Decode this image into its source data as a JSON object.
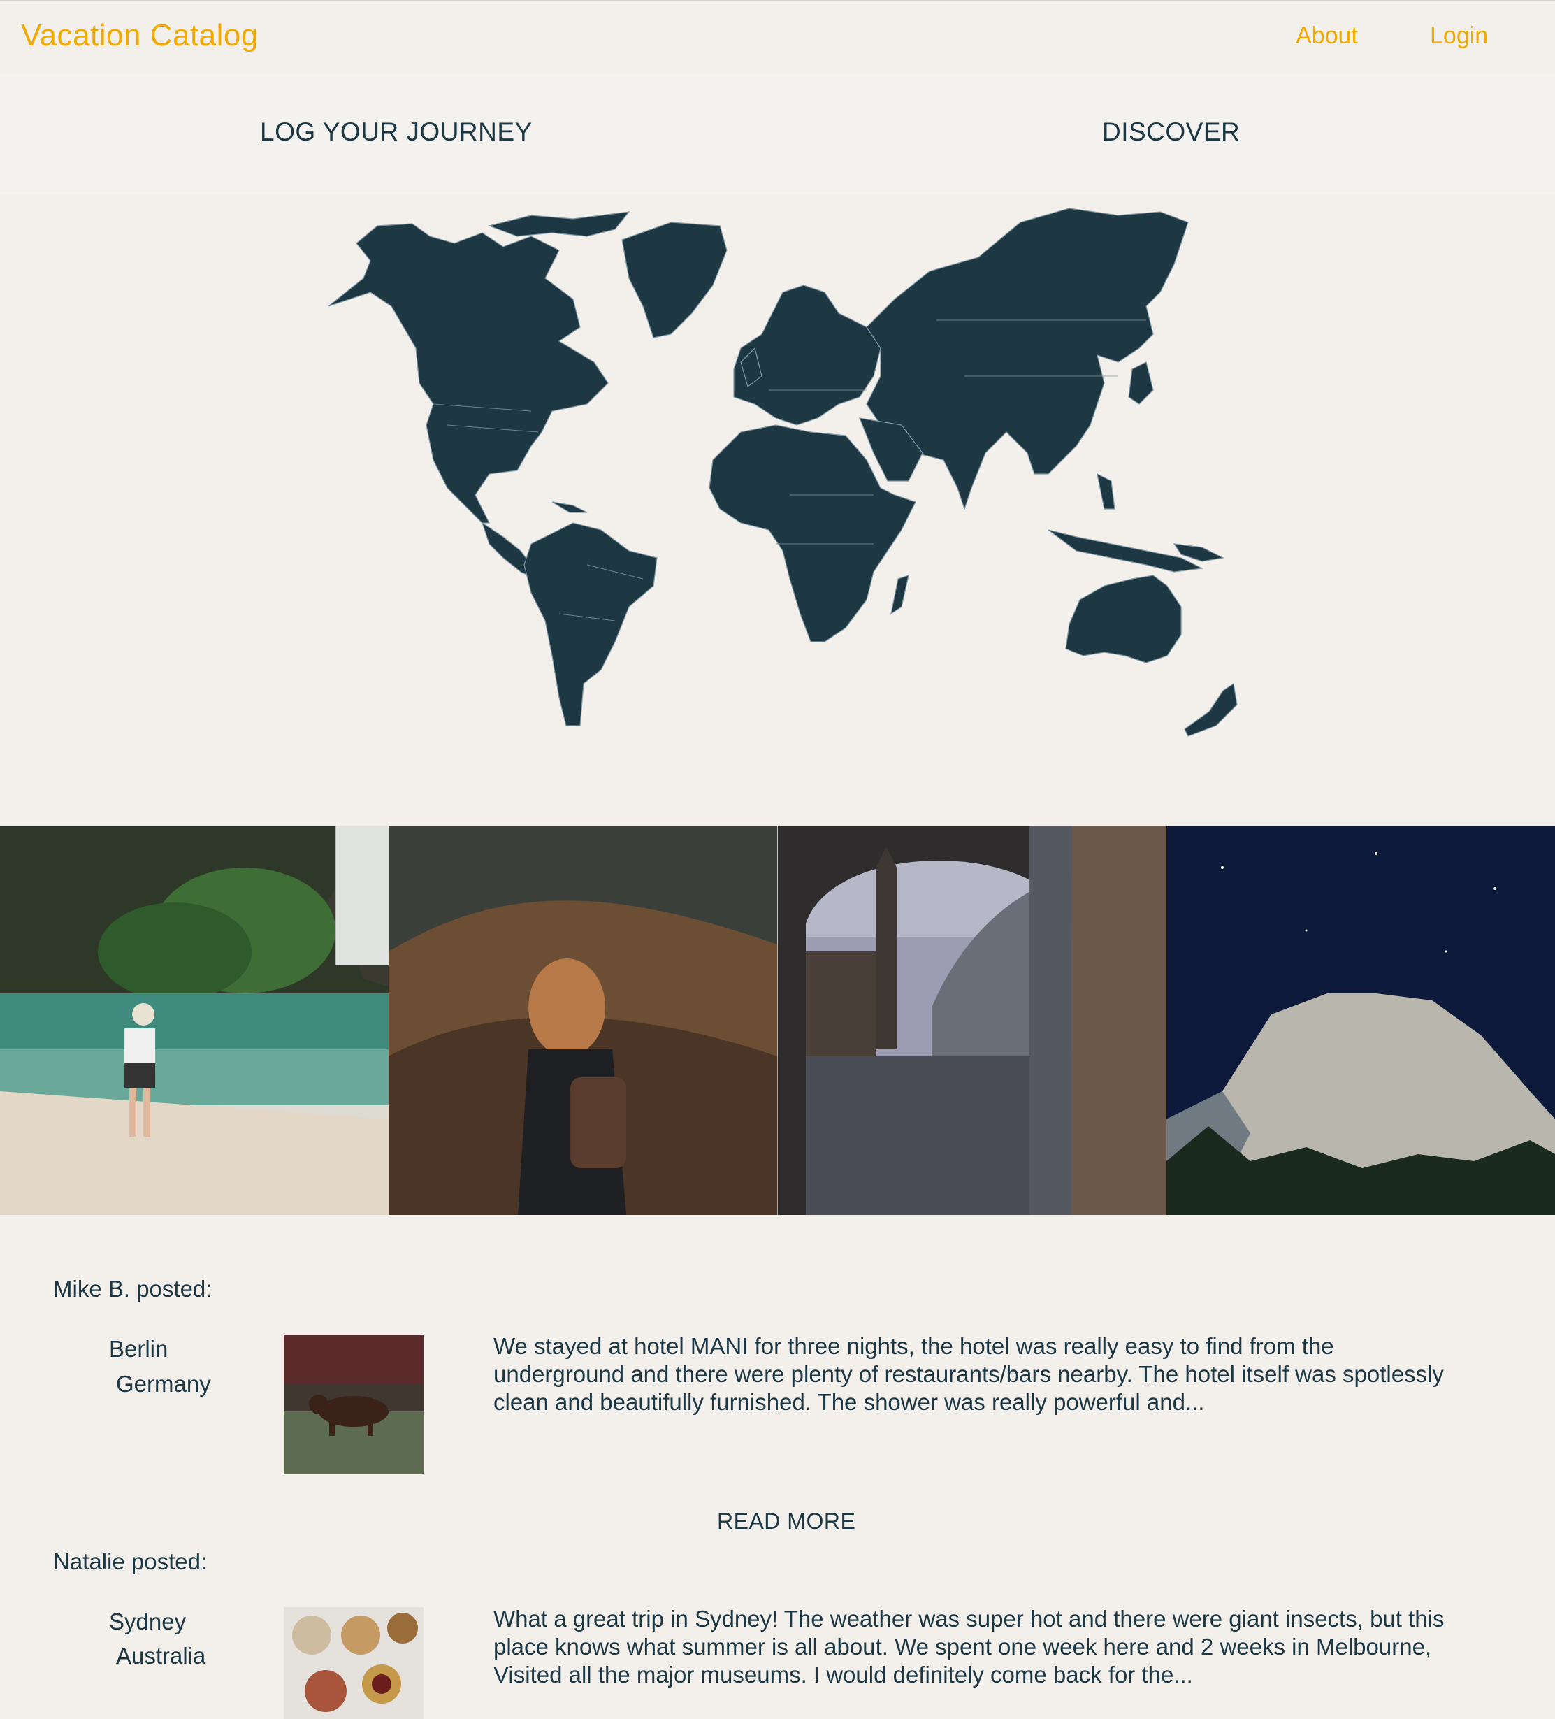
{
  "header": {
    "brand": "Vacation Catalog",
    "nav": {
      "about": "About",
      "login": "Login"
    }
  },
  "subnav": {
    "log_journey": "LOG YOUR JOURNEY",
    "discover": "DISCOVER"
  },
  "map": {
    "land_color": "#1d3743",
    "background": "#f3efeb"
  },
  "gallery": [
    {
      "icon": "beach-photo"
    },
    {
      "icon": "hiker-photo"
    },
    {
      "icon": "big-ben-photo"
    },
    {
      "icon": "mountain-photo"
    }
  ],
  "posts": [
    {
      "author": "Mike B. posted:",
      "city": "Berlin",
      "country": "Germany",
      "text": "We stayed at hotel MANI for three nights, the hotel was really easy to find from the underground and there were plenty of restaurants/bars nearby. The hotel itself was spotlessly clean and beautifully furnished. The shower was really powerful and..."
    },
    {
      "author": "Natalie posted:",
      "city": "Sydney",
      "country": "Australia",
      "text": "What a great trip in Sydney! The weather was super hot and there were giant insects, but this place knows what summer is all about. We spent one week here and 2 weeks in Melbourne, Visited all the major museums. I would definitely come back for the..."
    }
  ],
  "read_more": "READ MORE",
  "colors": {
    "accent": "#f2a900",
    "text": "#1c3744",
    "background": "#f3f0ec"
  }
}
